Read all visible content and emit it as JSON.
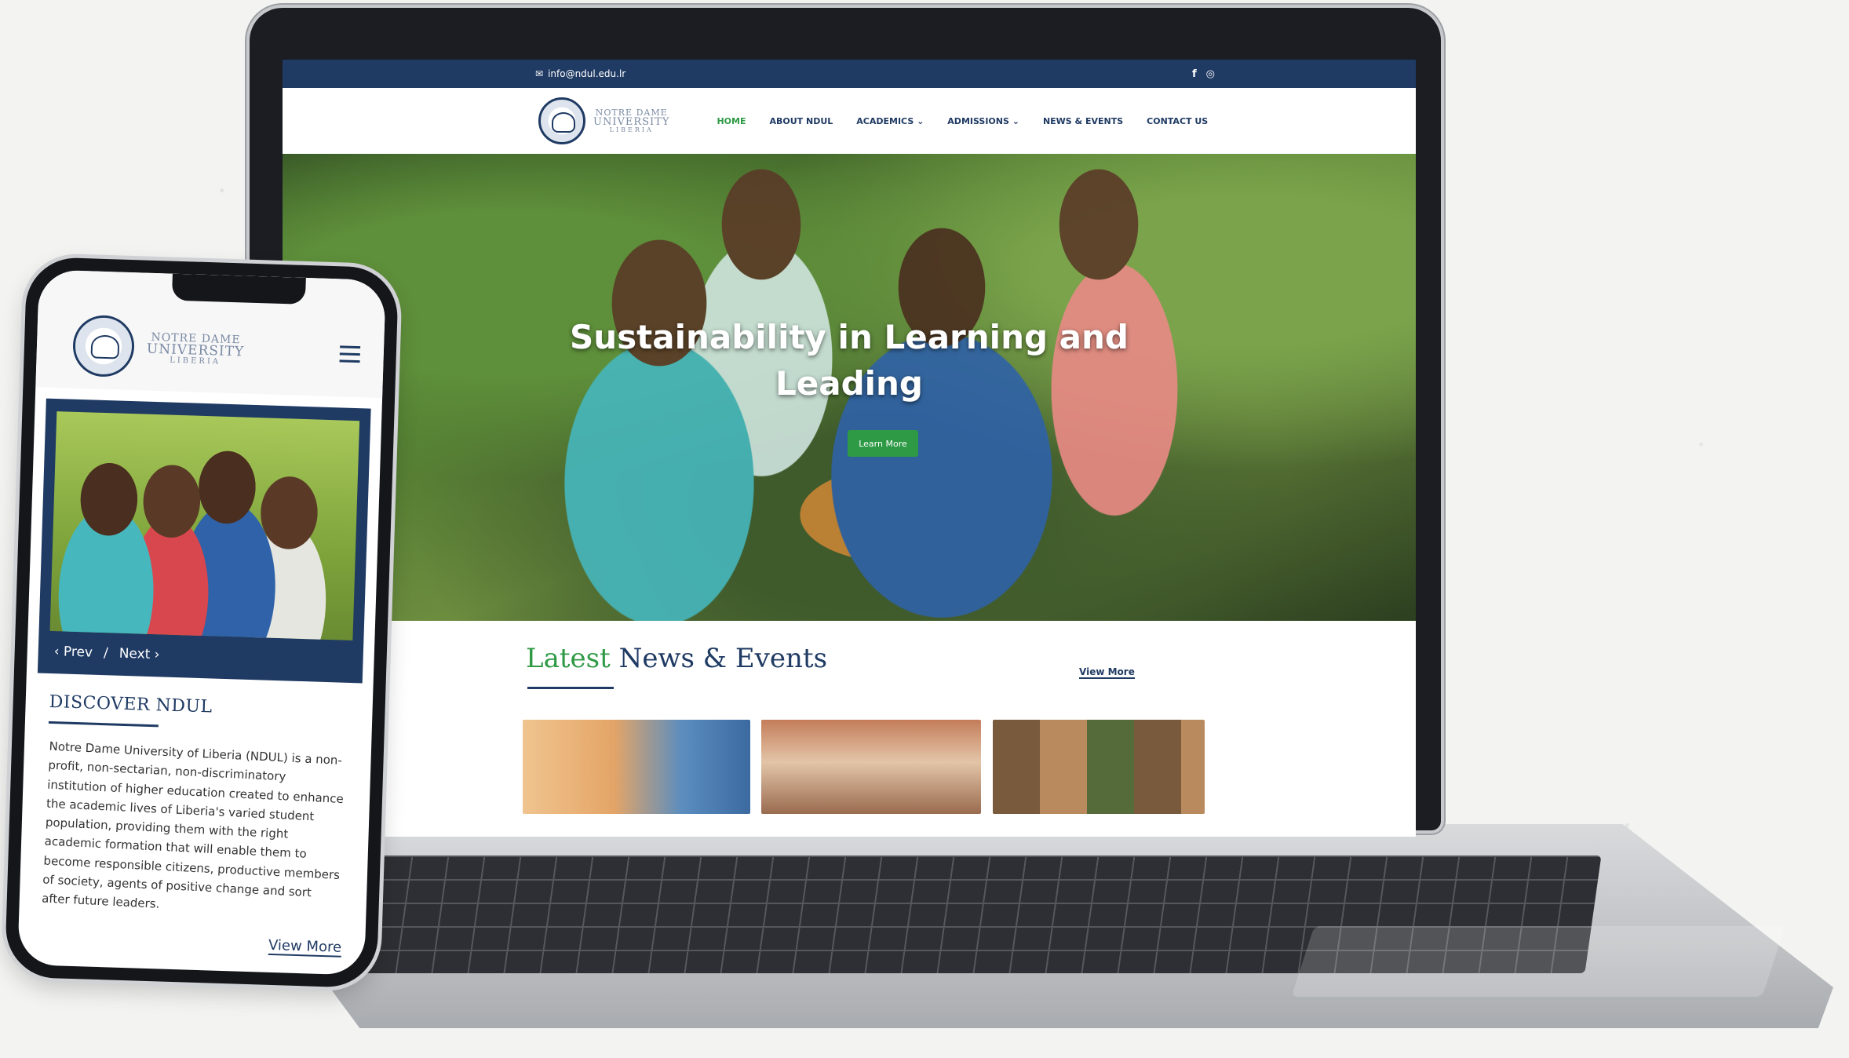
{
  "laptop_site": {
    "topbar": {
      "email": "info@ndul.edu.lr",
      "social_icons": [
        "facebook-icon",
        "instagram-icon"
      ]
    },
    "logo": {
      "line1": "NOTRE DAME",
      "line2": "UNIVERSITY",
      "line3": "LIBERIA"
    },
    "nav": [
      {
        "label": "HOME",
        "active": true
      },
      {
        "label": "ABOUT NDUL"
      },
      {
        "label": "ACADEMICS ⌄"
      },
      {
        "label": "ADMISSIONS ⌄"
      },
      {
        "label": "NEWS & EVENTS"
      },
      {
        "label": "CONTACT US"
      }
    ],
    "hero": {
      "title_line1": "Sustainability in Learning and",
      "title_line2": "Leading",
      "button": "Learn More"
    },
    "news": {
      "heading_accent": "Latest",
      "heading_rest": "News & Events",
      "view_more": "View More"
    }
  },
  "phone_site": {
    "logo": {
      "line1": "NOTRE DAME",
      "line2": "UNIVERSITY",
      "line3": "LIBERIA"
    },
    "slider": {
      "prev": "‹ Prev",
      "separator": "/",
      "next": "Next ›"
    },
    "discover": {
      "heading": "DISCOVER NDUL",
      "body": "Notre Dame University of Liberia (NDUL) is a non-profit, non-sectarian, non-discriminatory institution of higher education created to enhance the academic lives of Liberia's varied student population, providing them with the right academic formation that will enable them to become responsible citizens, productive members of society, agents of positive change and sort after future leaders.",
      "view_more": "View More"
    }
  },
  "colors": {
    "navy": "#1f3a63",
    "green": "#2e9a45"
  }
}
